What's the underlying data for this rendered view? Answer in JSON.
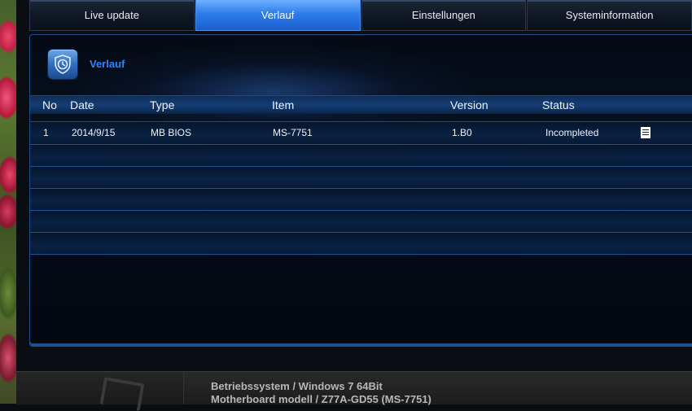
{
  "tabs": [
    {
      "label": "Live update",
      "active": false
    },
    {
      "label": "Verlauf",
      "active": true
    },
    {
      "label": "Einstellungen",
      "active": false
    },
    {
      "label": "Systeminformation",
      "active": false
    }
  ],
  "panel": {
    "title": "Verlauf",
    "icon": "history-shield-icon"
  },
  "table": {
    "headers": {
      "no": "No",
      "date": "Date",
      "type": "Type",
      "item": "Item",
      "version": "Version",
      "status": "Status"
    },
    "rows": [
      {
        "no": "1",
        "date": "2014/9/15",
        "type": "MB BIOS",
        "item": "MS-7751",
        "version": "1.B0",
        "status": "Incompleted",
        "icon": "document-icon"
      }
    ],
    "empty_rows": 5
  },
  "sysinfo": {
    "os_line": "Betriebssystem / Windows 7 64Bit",
    "board_line": "Motherboard modell / Z77A-GD55 (MS-7751)"
  },
  "colors": {
    "accent": "#2a86ff",
    "active_tab": "#2d7cea",
    "row_divider": "#1c5296"
  }
}
